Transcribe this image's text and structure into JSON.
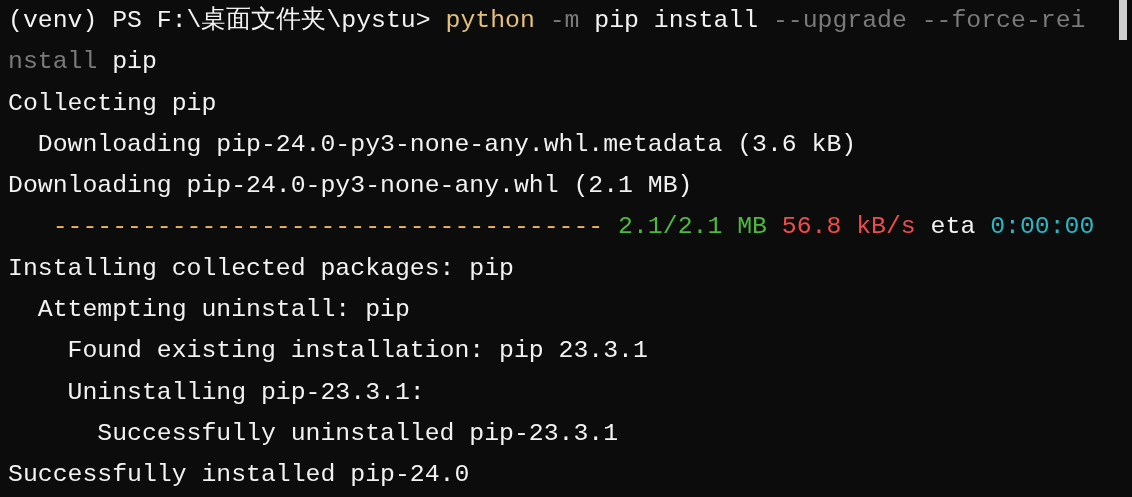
{
  "terminal": {
    "lines": [
      [
        {
          "text": "(venv) PS F:\\桌面文件夹\\pystu> ",
          "kind": "plain"
        },
        {
          "text": "python",
          "kind": "command"
        },
        {
          "text": " -m",
          "kind": "flag"
        },
        {
          "text": " pip install",
          "kind": "plain"
        },
        {
          "text": " --upgrade --force-rei",
          "kind": "flag"
        }
      ],
      [
        {
          "text": "nstall",
          "kind": "flag"
        },
        {
          "text": " pip",
          "kind": "plain"
        }
      ],
      [
        {
          "text": "Collecting pip",
          "kind": "plain"
        }
      ],
      [
        {
          "text": "  Downloading pip-24.0-py3-none-any.whl.metadata (3.6 kB)",
          "kind": "plain"
        }
      ],
      [
        {
          "text": "Downloading pip-24.0-py3-none-any.whl (2.1 MB)",
          "kind": "plain"
        }
      ],
      [
        {
          "text": "   ------------------------------------- ",
          "kind": "bar"
        },
        {
          "text": "2.1/2.1 MB",
          "kind": "size"
        },
        {
          "text": " 56.8 kB/s",
          "kind": "speed"
        },
        {
          "text": " eta",
          "kind": "plain"
        },
        {
          "text": " 0:00:00",
          "kind": "time"
        }
      ],
      [
        {
          "text": "Installing collected packages: pip",
          "kind": "plain"
        }
      ],
      [
        {
          "text": "  Attempting uninstall: pip",
          "kind": "plain"
        }
      ],
      [
        {
          "text": "    Found existing installation: pip 23.3.1",
          "kind": "plain"
        }
      ],
      [
        {
          "text": "    Uninstalling pip-23.3.1:",
          "kind": "plain"
        }
      ],
      [
        {
          "text": "      Successfully uninstalled pip-23.3.1",
          "kind": "plain"
        }
      ],
      [
        {
          "text": "Successfully installed pip-24.0",
          "kind": "plain"
        }
      ]
    ]
  }
}
